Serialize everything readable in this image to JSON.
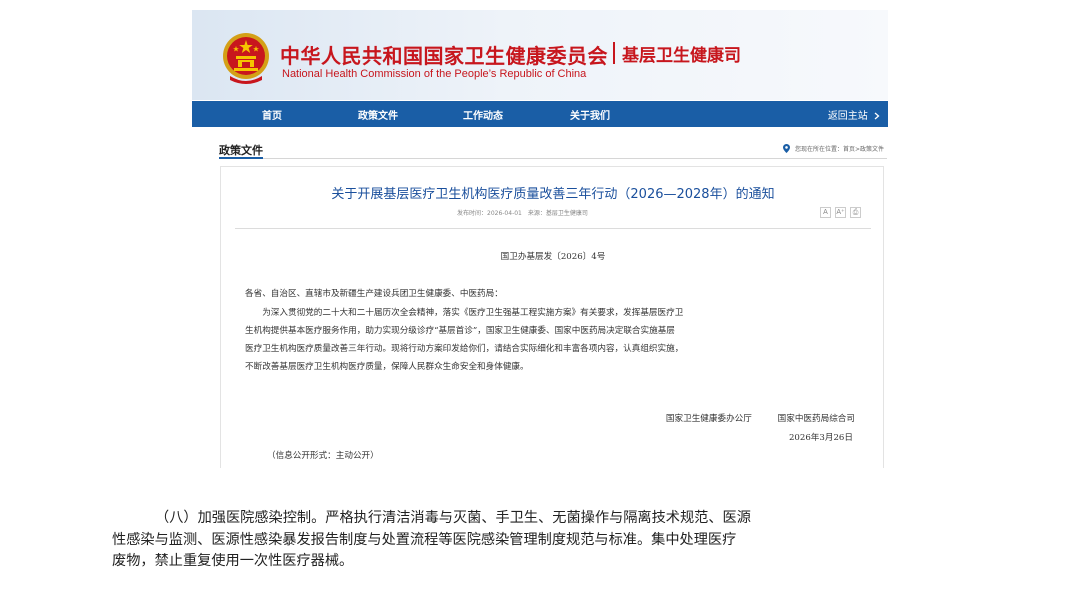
{
  "header": {
    "org_name_cn": "中华人民共和国国家卫生健康委员会",
    "org_name_en": "National Health Commission of the People’s Republic of China",
    "dept_name": "基层卫生健康司"
  },
  "nav": {
    "items": [
      {
        "label": "首页"
      },
      {
        "label": "政策文件"
      },
      {
        "label": "工作动态"
      },
      {
        "label": "关于我们"
      }
    ],
    "back_label": "返回主站"
  },
  "section": {
    "title": "政策文件",
    "location_text": "您现在所在位置：首页>政策文件"
  },
  "article": {
    "title": "关于开展基层医疗卫生机构医疗质量改善三年行动（2026—2028年）的通知",
    "meta": "发布时间：2026-04-01　来源：基层卫生健康司",
    "tools": {
      "small": "A",
      "large": "A⁺",
      "print": "⎙"
    },
    "doc_number": "国卫办基层发〔2026〕4号",
    "salutation": "各省、自治区、直辖市及新疆生产建设兵团卫生健康委、中医药局：",
    "para_lines": [
      "　　为深入贯彻党的二十大和二十届历次全会精神，落实《医疗卫生强基工程实施方案》有关要求，发挥基层医疗卫",
      "生机构提供基本医疗服务作用，助力实现分级诊疗“基层首诊”，国家卫生健康委、国家中医药局决定联合实施基层",
      "医疗卫生机构医疗质量改善三年行动。现将行动方案印发给你们，请结合实际细化和丰富各项内容，认真组织实施，",
      "不断改善基层医疗卫生机构医疗质量，保障人民群众生命安全和身体健康。"
    ],
    "issuers": "国家卫生健康委办公厅　　　国家中医药局综合司",
    "date": "2026年3月26日",
    "disclosure": "（信息公开形式：主动公开）"
  },
  "excerpt": {
    "lines": [
      "（八）加强医院感染控制。严格执行清洁消毒与灭菌、手卫生、无菌操作与隔离技术规范、医源",
      "性感染与监测、医源性感染暴发报告制度与处置流程等医院感染管理制度规范与标准。集中处理医疗",
      "废物，禁止重复使用一次性医疗器械。"
    ]
  },
  "icons": {
    "emblem": "national-emblem-icon",
    "location": "location-pin-icon",
    "back": "chevron-right-icon"
  },
  "colors": {
    "brand_red": "#c7161d",
    "nav_blue": "#1a5ea6",
    "title_blue": "#1a4f9c"
  }
}
